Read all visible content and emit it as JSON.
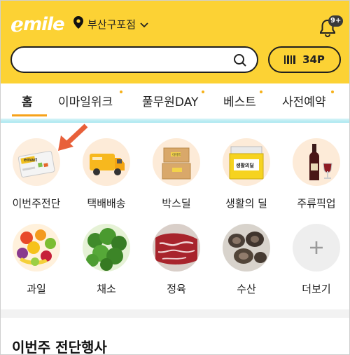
{
  "header": {
    "logo_letter": "e",
    "logo_text": "mile",
    "store_name": "부산구포점",
    "notification_count": "9+",
    "search_placeholder": "",
    "points_label": "34P",
    "brand_color": "#fcd234"
  },
  "tabs": [
    {
      "label": "홈",
      "active": true,
      "dot": false
    },
    {
      "label": "이마일위크",
      "active": false,
      "dot": true
    },
    {
      "label": "풀무원DAY",
      "active": false,
      "dot": true
    },
    {
      "label": "베스트",
      "active": false,
      "dot": true
    },
    {
      "label": "사전예약",
      "active": false,
      "dot": true
    }
  ],
  "categories": [
    {
      "label": "이번주전단",
      "icon": "emart-flyer-icon"
    },
    {
      "label": "택배배송",
      "icon": "delivery-truck-icon"
    },
    {
      "label": "박스딜",
      "icon": "box-icon"
    },
    {
      "label": "생활의 딜",
      "icon": "household-deal-icon"
    },
    {
      "label": "주류픽업",
      "icon": "wine-bottle-icon"
    },
    {
      "label": "과일",
      "icon": "fruit-icon"
    },
    {
      "label": "채소",
      "icon": "vegetable-icon"
    },
    {
      "label": "정육",
      "icon": "meat-icon"
    },
    {
      "label": "수산",
      "icon": "seafood-icon"
    },
    {
      "label": "더보기",
      "icon": "plus-icon"
    }
  ],
  "thumbnail_text": {
    "flyer_brand": "emart",
    "box_text": "이마트",
    "household_text": "생활의딜"
  },
  "section": {
    "title": "이번주 전단행사"
  }
}
